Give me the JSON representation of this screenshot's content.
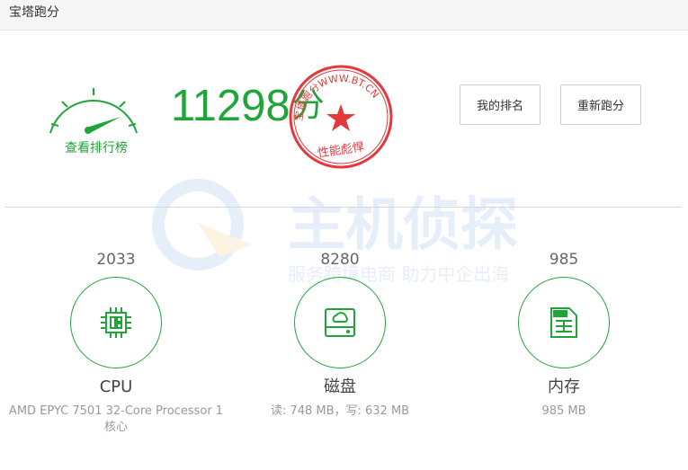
{
  "window": {
    "title": "宝塔跑分"
  },
  "score": {
    "value": "11298",
    "unit": "分",
    "ranking_link": "查看排行榜"
  },
  "stamp": {
    "ring_text": "宝塔跑分WWW.BT.CN",
    "bottom_text": "性能彪悍"
  },
  "buttons": {
    "my_rank": "我的排名",
    "rerun": "重新跑分"
  },
  "watermark": {
    "title": "主机侦探",
    "slogan": "服务跨境电商 助力中企出海"
  },
  "stats": {
    "cpu": {
      "value": "2033",
      "label": "CPU",
      "detail": "AMD EPYC 7501 32-Core Processor 1 核心",
      "icon": "chip-icon"
    },
    "disk": {
      "value": "8280",
      "label": "磁盘",
      "detail": "读: 748 MB，写: 632 MB",
      "icon": "hard-disk-icon"
    },
    "memory": {
      "value": "985",
      "label": "内存",
      "detail": "985 MB",
      "icon": "memory-icon"
    }
  },
  "colors": {
    "accent": "#20a53a",
    "stamp_red": "#e4393c",
    "text_muted": "#999999"
  }
}
